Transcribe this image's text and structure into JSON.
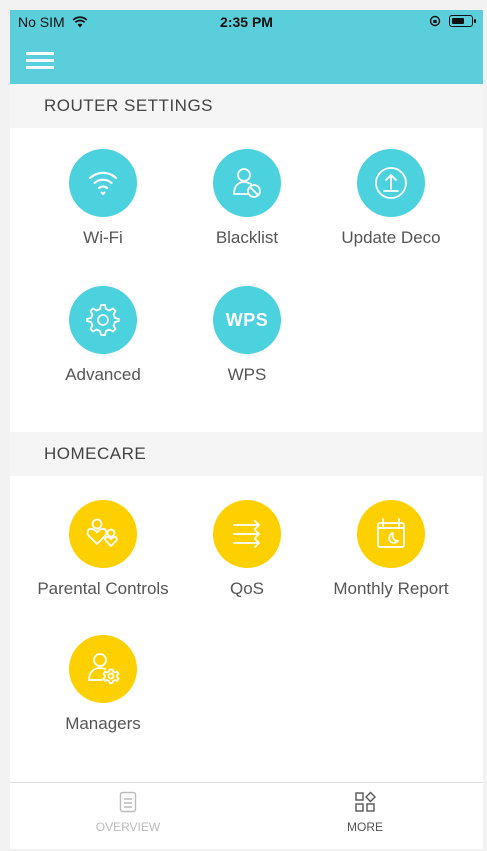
{
  "status_bar": {
    "carrier": "No SIM",
    "time": "2:35 PM"
  },
  "header": {
    "menu_icon": "hamburger-menu-icon",
    "color": "#5acfdb"
  },
  "router_settings": {
    "title": "ROUTER SETTINGS",
    "items": [
      {
        "label": "Wi-Fi",
        "icon": "wifi-icon"
      },
      {
        "label": "Blacklist",
        "icon": "blacklist-user-icon"
      },
      {
        "label": "Update Deco",
        "icon": "update-upload-icon"
      },
      {
        "label": "Advanced",
        "icon": "gear-icon"
      },
      {
        "label": "WPS",
        "icon_text": "WPS"
      }
    ],
    "color": "#4cd1de"
  },
  "homecare": {
    "title": "HOMECARE",
    "items": [
      {
        "label": "Parental Controls",
        "icon": "parental-heart-icon"
      },
      {
        "label": "QoS",
        "icon": "qos-arrows-icon"
      },
      {
        "label": "Monthly Report",
        "icon": "calendar-moon-icon"
      },
      {
        "label": "Managers",
        "icon": "manager-gear-icon"
      }
    ],
    "color": "#ffd000"
  },
  "tab_bar": {
    "tabs": [
      {
        "label": "OVERVIEW",
        "icon": "document-list-icon",
        "active": false
      },
      {
        "label": "MORE",
        "icon": "grid-more-icon",
        "active": true
      }
    ]
  }
}
